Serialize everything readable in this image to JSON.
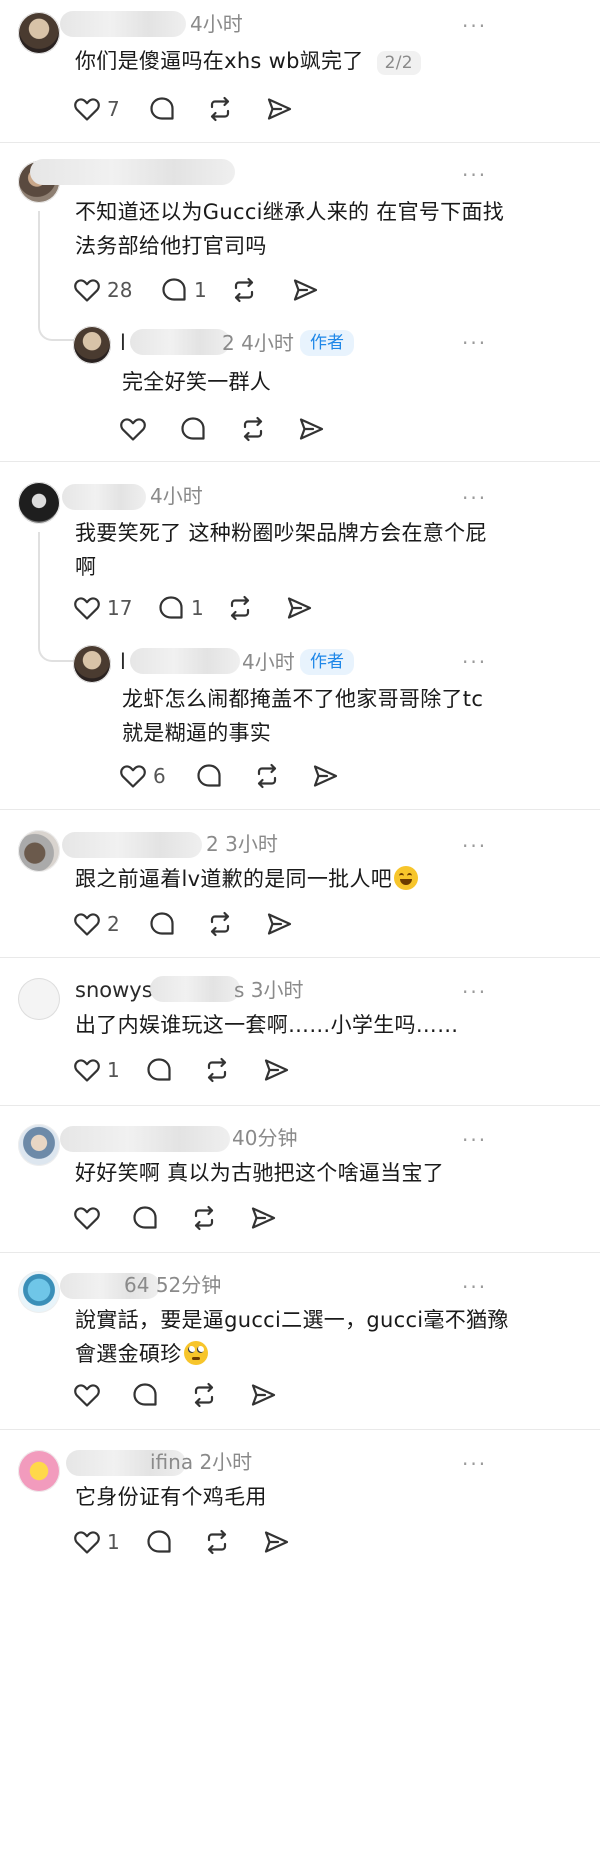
{
  "icons": [
    "heart-icon",
    "comment-icon",
    "repost-icon",
    "share-icon",
    "more-icon"
  ],
  "author_badge": "作者",
  "more_label": "···",
  "posts": [
    {
      "name": "l",
      "time": "4小时",
      "text": "你们是傻逼吗在xhs wb飒完了",
      "page": "2/2",
      "likes": "7",
      "comments": ""
    },
    {
      "name": "",
      "time": "",
      "text_line1": "不知道还以为Gucci继承人来的 在官号下面找",
      "text_line2": "法务部给他打官司吗",
      "likes": "28",
      "comments": "1"
    },
    {
      "name": "l",
      "time_suffix": "2",
      "time": "4小时",
      "text": "完全好笑一群人",
      "likes": "",
      "comments": ""
    },
    {
      "name": "",
      "time": "4小时",
      "text_line1": "我要笑死了 这种粉圈吵架品牌方会在意个屁",
      "text_line2": "啊",
      "likes": "17",
      "comments": "1"
    },
    {
      "name": "l",
      "time": "4小时",
      "text_line1": "龙虾怎么闹都掩盖不了他家哥哥除了tc",
      "text_line2": "就是糊逼的事实",
      "likes": "6",
      "comments": ""
    },
    {
      "name": "",
      "time_suffix": "2",
      "time": "3小时",
      "text": "跟之前逼着lv道歉的是同一批人吧",
      "likes": "2",
      "comments": ""
    },
    {
      "name": "snowyst",
      "time_suffix": "s",
      "time": "3小时",
      "text": "出了内娱谁玩这一套啊……小学生吗……",
      "likes": "1",
      "comments": ""
    },
    {
      "name": "",
      "time": "40分钟",
      "text": "好好笑啊 真以为古驰把这个啥逼当宝了",
      "likes": "",
      "comments": ""
    },
    {
      "name": "",
      "time_suffix": "64",
      "time": "52分钟",
      "text_line1": "說實話，要是逼gucci二選一，gucci毫不猶豫",
      "text_line2": "會選金碩珍",
      "likes": "",
      "comments": ""
    },
    {
      "name": "sall",
      "time_suffix": "ifina",
      "time": "2小时",
      "text": "它身份证有个鸡毛用",
      "likes": "1",
      "comments": ""
    }
  ]
}
